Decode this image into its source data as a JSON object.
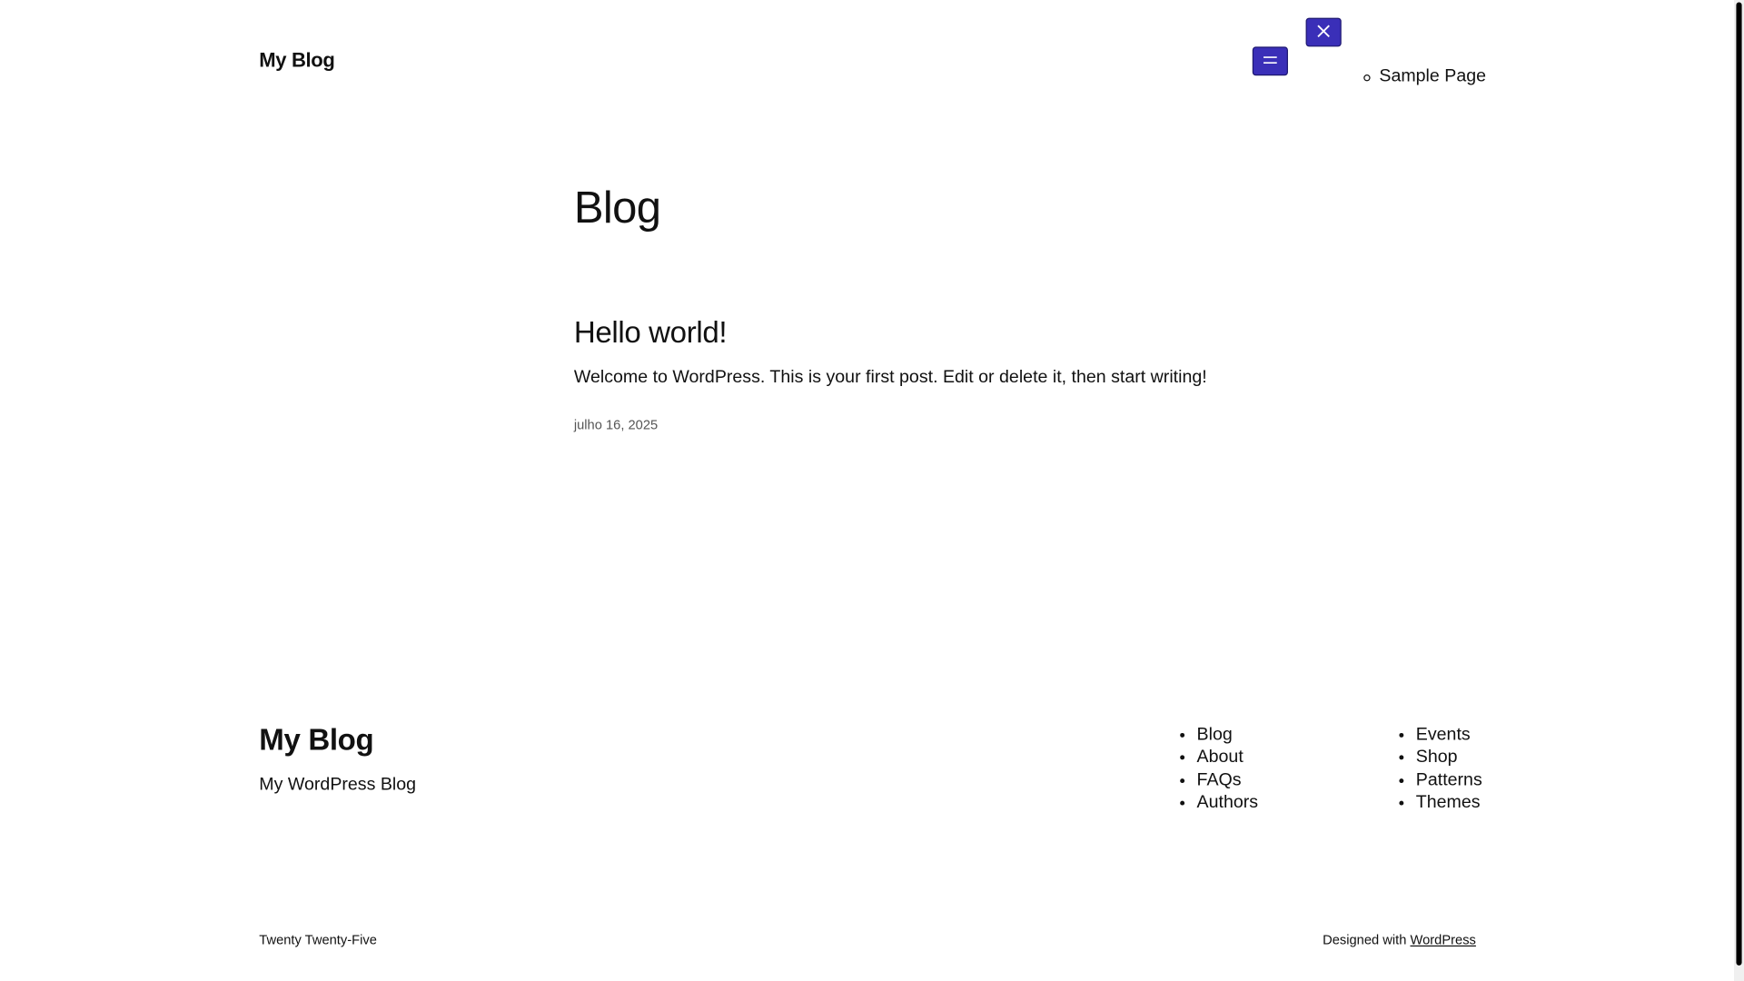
{
  "header": {
    "site_title": "My Blog",
    "menu_open_icon": "hamburger-icon",
    "menu_close_icon": "close-icon",
    "nav_items": [
      {
        "label": "Sample Page"
      }
    ]
  },
  "main": {
    "page_heading": "Blog",
    "posts": [
      {
        "title": "Hello world!",
        "excerpt": "Welcome to WordPress. This is your first post. Edit or delete it, then start writing!",
        "date": "julho 16, 2025"
      }
    ]
  },
  "footer": {
    "site_title": "My Blog",
    "tagline": "My WordPress Blog",
    "nav_column_1": [
      "Blog",
      "About",
      "FAQs",
      "Authors"
    ],
    "nav_column_2": [
      "Events",
      "Shop",
      "Patterns",
      "Themes"
    ],
    "theme_credit": "Twenty Twenty-Five",
    "designed_with_text": "Designed with",
    "designed_with_link": "WordPress"
  },
  "colors": {
    "accent_button": "#3a2fb8",
    "text": "#111111",
    "muted_text": "#555555",
    "background": "#ffffff"
  }
}
